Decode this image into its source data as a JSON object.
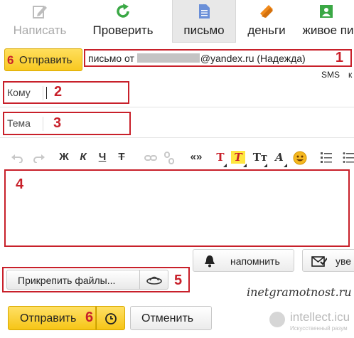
{
  "toolbar": {
    "write_label": "Написать",
    "check_label": "Проверить",
    "letter_label": "письмо",
    "money_label": "деньги",
    "live_label": "живое пи"
  },
  "send_top": {
    "number": "6",
    "label": "Отправить"
  },
  "from": {
    "prefix": "письмо от",
    "domain": "@yandex.ru (Надежда)",
    "number": "1"
  },
  "links": {
    "sms": "SMS",
    "k": "к"
  },
  "to": {
    "label": "Кому",
    "value": "",
    "number": "2"
  },
  "subject": {
    "label": "Тема",
    "value": "",
    "number": "3"
  },
  "format_toolbar": {
    "bold": "Ж",
    "italic": "К",
    "underline": "Ч",
    "strike": "Т",
    "quotes": "«»",
    "text_color": "Т",
    "bg_color": "Т",
    "font_size": "Тт",
    "font": "A"
  },
  "editor": {
    "number": "4"
  },
  "remind": {
    "label": "напомнить"
  },
  "notify": {
    "label": "уве"
  },
  "attach": {
    "label": "Прикрепить файлы...",
    "number": "5"
  },
  "watermark": "inetgramotnost.ru",
  "send_bottom": {
    "label": "Отправить",
    "number": "6"
  },
  "cancel": {
    "label": "Отменить"
  },
  "logo": {
    "name": "intellect.icu",
    "tagline": "Искусственный разум"
  },
  "colors": {
    "accent_red": "#c8202a",
    "send_yellow": "#f8c820",
    "check_green": "#3aa845",
    "money_orange": "#f08a1c",
    "letter_blue": "#6a8fd8"
  }
}
